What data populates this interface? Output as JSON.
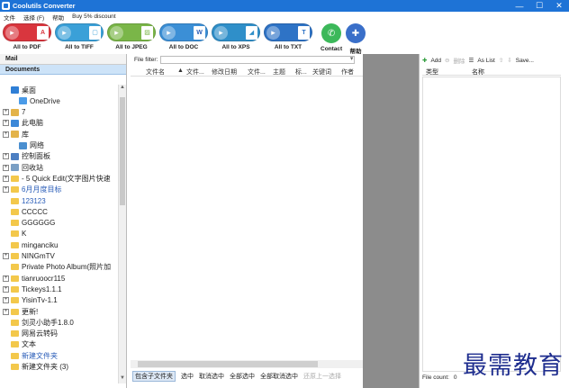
{
  "window": {
    "title": "Coolutils Converter",
    "minimize": "—",
    "maximize": "☐",
    "close": "✕"
  },
  "menu": [
    "文件",
    "选择 (F)",
    "帮助",
    "Buy 5% discount"
  ],
  "toolbar": [
    {
      "label": "All to PDF",
      "color": "#d9363e",
      "glyph": "A",
      "glyph_color": "#d9363e"
    },
    {
      "label": "All to TIFF",
      "color": "#3aa0d8",
      "glyph": "▢",
      "glyph_color": "#3aa0d8"
    },
    {
      "label": "All to JPEG",
      "color": "#7ab648",
      "glyph": "▨",
      "glyph_color": "#7ab648"
    },
    {
      "label": "All to DOC",
      "color": "#3b8fd6",
      "glyph": "W",
      "glyph_color": "#2b5fb8"
    },
    {
      "label": "All to XPS",
      "color": "#2f8fc9",
      "glyph": "◢",
      "glyph_color": "#2f8fc9"
    },
    {
      "label": "All to TXT",
      "color": "#2e73c6",
      "glyph": "T",
      "glyph_color": "#2e73c6"
    }
  ],
  "extra_buttons": [
    {
      "label": "Contact",
      "color": "#3cb85a",
      "glyph": "✆"
    },
    {
      "label": "帮助",
      "color": "#3a6fc9",
      "glyph": "✚"
    }
  ],
  "left_tabs": {
    "mail": "Mail",
    "documents": "Documents"
  },
  "tree": [
    {
      "label": "桌面",
      "expander": "",
      "indent": 0,
      "icon": "desktop"
    },
    {
      "label": "OneDrive",
      "expander": "",
      "indent": 1,
      "icon": "cloud"
    },
    {
      "label": "7",
      "expander": "+",
      "indent": 0,
      "icon": "user"
    },
    {
      "label": "此电脑",
      "expander": "+",
      "indent": 0,
      "icon": "pc"
    },
    {
      "label": "库",
      "expander": "+",
      "indent": 0,
      "icon": "lib"
    },
    {
      "label": "网络",
      "expander": "",
      "indent": 1,
      "icon": "net"
    },
    {
      "label": "控制面板",
      "expander": "+",
      "indent": 0,
      "icon": "panel"
    },
    {
      "label": "回收站",
      "expander": "+",
      "indent": 0,
      "icon": "bin"
    },
    {
      "label": "- 5 Quick Edit(文字图片快速",
      "expander": "+",
      "indent": 0,
      "icon": "folder"
    },
    {
      "label": "6月月度目标",
      "expander": "+",
      "indent": 0,
      "icon": "folder",
      "link": true
    },
    {
      "label": "123123",
      "expander": "",
      "indent": 0,
      "icon": "folder",
      "link": true
    },
    {
      "label": "CCCCC",
      "expander": "",
      "indent": 0,
      "icon": "folder"
    },
    {
      "label": "GGGGGG",
      "expander": "",
      "indent": 0,
      "icon": "folder"
    },
    {
      "label": "K",
      "expander": "",
      "indent": 0,
      "icon": "folder"
    },
    {
      "label": "minganciku",
      "expander": "",
      "indent": 0,
      "icon": "folder"
    },
    {
      "label": "NINGmTV",
      "expander": "+",
      "indent": 0,
      "icon": "folder"
    },
    {
      "label": "Private Photo Album(照片加",
      "expander": "",
      "indent": 0,
      "icon": "folder"
    },
    {
      "label": "tianruoocr115",
      "expander": "+",
      "indent": 0,
      "icon": "folder"
    },
    {
      "label": "Tickeys1.1.1",
      "expander": "+",
      "indent": 0,
      "icon": "folder"
    },
    {
      "label": "YisinTv-1.1",
      "expander": "+",
      "indent": 0,
      "icon": "folder"
    },
    {
      "label": "更新!",
      "expander": "+",
      "indent": 0,
      "icon": "folder"
    },
    {
      "label": "剑灵小助手1.8.0",
      "expander": "",
      "indent": 0,
      "icon": "folder"
    },
    {
      "label": "网易云转码",
      "expander": "",
      "indent": 0,
      "icon": "folder"
    },
    {
      "label": "文本",
      "expander": "",
      "indent": 0,
      "icon": "folder"
    },
    {
      "label": "新建文件夹",
      "expander": "",
      "indent": 0,
      "icon": "folder",
      "link": true
    },
    {
      "label": "新建文件夹 (3)",
      "expander": "",
      "indent": 0,
      "icon": "folder"
    }
  ],
  "file_filter": {
    "label": "File filter:",
    "value": ""
  },
  "file_columns": [
    "文件名",
    "▲",
    "文件...",
    "修改日期",
    "文件...",
    "主题",
    "标...",
    "关键词",
    "作者"
  ],
  "bottom_buttons": [
    "包含子文件夹",
    "选中",
    "取消选中",
    "全部选中",
    "全部取消选中",
    "还原上一选择"
  ],
  "right_toolbar": {
    "add": "Add",
    "delete": "删除",
    "as_list": "As List",
    "up": "⇧",
    "down": "⇩",
    "save": "Save..."
  },
  "right_columns": [
    "类型",
    "名称"
  ],
  "file_count": {
    "label": "File count:",
    "value": "0"
  },
  "watermark": "最需教育"
}
